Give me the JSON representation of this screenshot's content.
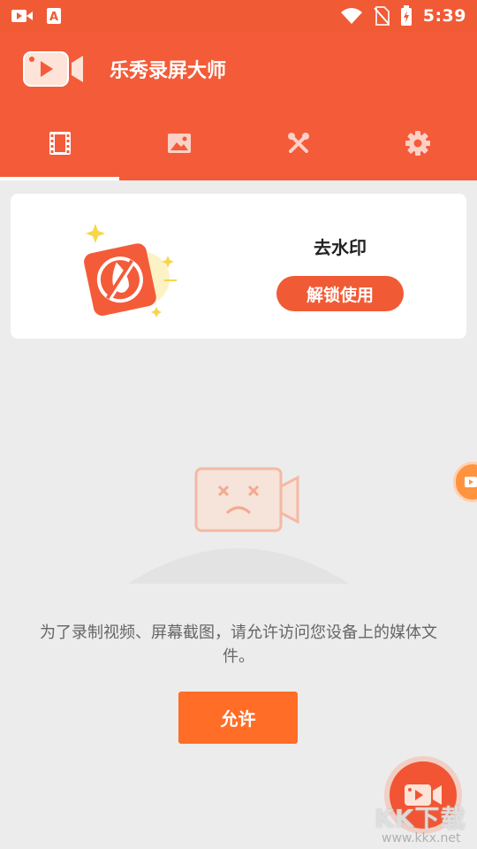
{
  "status_bar": {
    "time": "5:39",
    "icons": [
      "video-icon",
      "app-a-icon",
      "wifi-icon",
      "no-sim-icon",
      "battery-charging-icon"
    ]
  },
  "header": {
    "title": "乐秀录屏大师",
    "logo_icon": "video-camera-logo"
  },
  "tabs": [
    {
      "icon": "film-icon",
      "active": true
    },
    {
      "icon": "image-icon",
      "active": false
    },
    {
      "icon": "tools-icon",
      "active": false
    },
    {
      "icon": "gear-icon",
      "active": false
    }
  ],
  "promo": {
    "title": "去水印",
    "button_label": "解锁使用",
    "illustration_icon": "remove-watermark-icon"
  },
  "empty_state": {
    "illustration_icon": "sad-video-camera-icon",
    "permission_text": "为了录制视频、屏幕截图，请允许访问您设备上的媒体文件。",
    "allow_label": "允许"
  },
  "floating": {
    "side_icon": "floating-recorder-icon",
    "fab_icon": "record-video-icon"
  },
  "watermark": {
    "main": "KK下载",
    "sub": "www.kkx.net"
  },
  "colors": {
    "brand": "#f45b38",
    "button": "#f05a35",
    "allow": "#ff6d27",
    "background": "#ececec"
  }
}
